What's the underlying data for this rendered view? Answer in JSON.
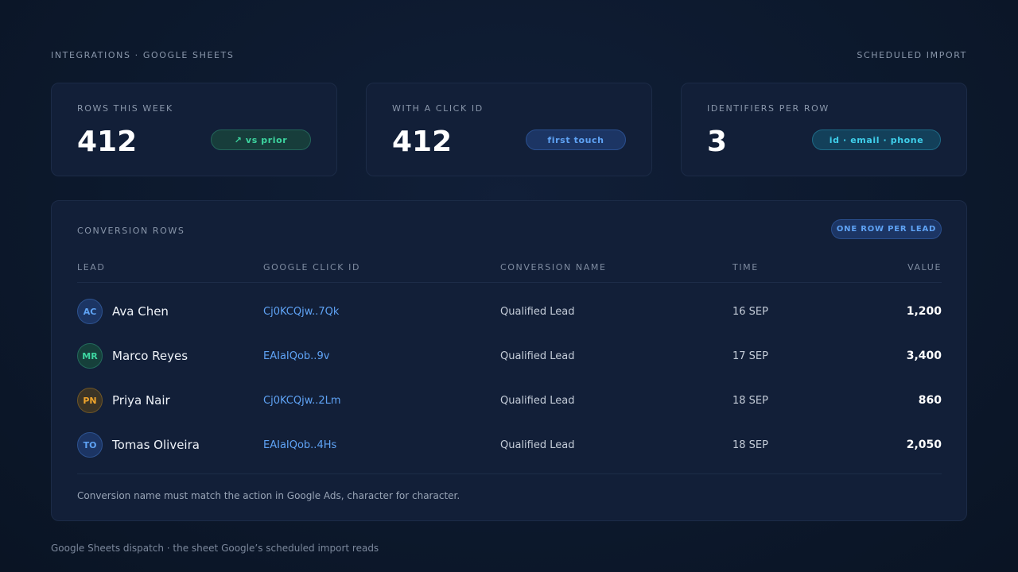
{
  "header": {
    "breadcrumb": "INTEGRATIONS · GOOGLE SHEETS",
    "right_label": "SCHEDULED IMPORT"
  },
  "stats": [
    {
      "label": "ROWS THIS WEEK",
      "value": "412",
      "pill": "↗ vs prior",
      "pill_color": "#3dd6a0"
    },
    {
      "label": "WITH A CLICK ID",
      "value": "412",
      "pill": "first touch",
      "pill_color": "#5fa3f5"
    },
    {
      "label": "IDENTIFIERS PER ROW",
      "value": "3",
      "pill": "id · email · phone",
      "pill_color": "#3fd0ec"
    }
  ],
  "panel": {
    "title": "CONVERSION ROWS",
    "badge": "ONE ROW PER LEAD",
    "columns": [
      "LEAD",
      "GOOGLE CLICK ID",
      "CONVERSION NAME",
      "TIME",
      "VALUE"
    ],
    "rows": [
      {
        "initials": "AC",
        "name": "Ava Chen",
        "gclid": "Cj0KCQjw..7Qk",
        "conversion": "Qualified Lead",
        "time": "16 SEP",
        "value": "1,200",
        "avatar_color": "#5fa3f5"
      },
      {
        "initials": "MR",
        "name": "Marco Reyes",
        "gclid": "EAIaIQob..9v",
        "conversion": "Qualified Lead",
        "time": "17 SEP",
        "value": "3,400",
        "avatar_color": "#3dd6a0"
      },
      {
        "initials": "PN",
        "name": "Priya Nair",
        "gclid": "Cj0KCQjw..2Lm",
        "conversion": "Qualified Lead",
        "time": "18 SEP",
        "value": "860",
        "avatar_color": "#f0a52c"
      },
      {
        "initials": "TO",
        "name": "Tomas Oliveira",
        "gclid": "EAIaIQob..4Hs",
        "conversion": "Qualified Lead",
        "time": "18 SEP",
        "value": "2,050",
        "avatar_color": "#5fa3f5"
      }
    ],
    "note": "Conversion name must match the action in Google Ads, character for character."
  },
  "footer": "Google Sheets dispatch · the sheet Google’s scheduled import reads",
  "colors": {
    "background": "#0d1a2f",
    "card": "#121f38",
    "accent_blue": "#5fa3f5",
    "accent_green": "#3dd6a0",
    "accent_cyan": "#3fd0ec",
    "accent_amber": "#f0a52c"
  }
}
